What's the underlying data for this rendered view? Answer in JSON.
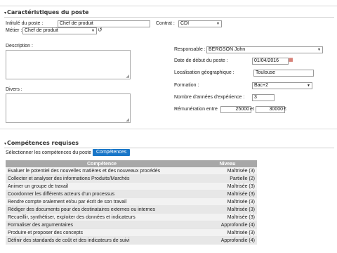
{
  "characteristics": {
    "title": "Caractéristiques du poste",
    "intitule_label": "Intitulé du poste :",
    "intitule_value": "Chef de produit",
    "contrat_label": "Contrat :",
    "contrat_value": "CDI",
    "metier_label": "Métier :",
    "metier_value": "Chef de produit",
    "description_label": "Description :",
    "divers_label": "Divers :",
    "responsable_label": "Responsable :",
    "responsable_value": "BERGSON John",
    "date_label": "Date de début du poste :",
    "date_value": "01/04/2016",
    "localisation_label": "Localisation géographique :",
    "localisation_value": "Toulouse",
    "formation_label": "Formation :",
    "formation_value": "Bac+2",
    "experience_label": "Nombre d'années d'expérience :",
    "experience_value": "3",
    "remuneration_label": "Rémunération entre",
    "remuneration_min": "25000",
    "remuneration_and": "et",
    "remuneration_max": "30000",
    "currency": "€"
  },
  "competences": {
    "title": "Compétences requises",
    "select_label": "Sélectionner les compétences du poste :",
    "select_button": "Compétences",
    "col_competence": "Compétence",
    "col_niveau": "Niveau",
    "rows": [
      {
        "name": "Evaluer le potentiel des nouvelles matières et des nouveaux procédés",
        "level": "Maîtrisée (3)"
      },
      {
        "name": "Collecter et analyser des informations Produits/Marchés",
        "level": "Partielle (2)"
      },
      {
        "name": "Animer un groupe de travail",
        "level": "Maîtrisée (3)"
      },
      {
        "name": "Coordonner les différents acteurs d'un processus",
        "level": "Maîtrisée (3)"
      },
      {
        "name": "Rendre compte oralement et/ou par écrit de son travail",
        "level": "Maîtrisée (3)"
      },
      {
        "name": "Rédiger des documents pour des destinataires externes ou internes",
        "level": "Maîtrisée (3)"
      },
      {
        "name": "Recueillir, synthétiser, exploiter des données et indicateurs",
        "level": "Maîtrisée (3)"
      },
      {
        "name": "Formaliser des argumentaires",
        "level": "Approfondie (4)"
      },
      {
        "name": "Produire et proposer des concepts",
        "level": "Maîtrisée (3)"
      },
      {
        "name": "Définir des standards de coût et des indicateurs de suivi",
        "level": "Approfondie (4)"
      }
    ]
  },
  "colors": {
    "button": "#1976c8",
    "table_header": "#a8a8a8"
  }
}
